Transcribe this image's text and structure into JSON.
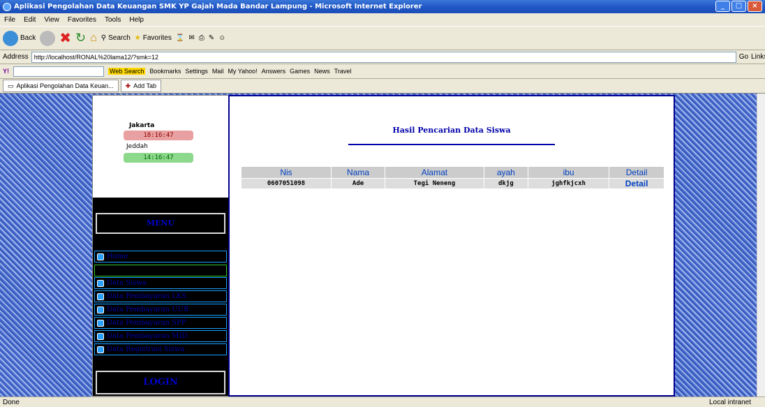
{
  "window": {
    "title": "Aplikasi Pengolahan Data Keuangan SMK YP Gajah Mada Bandar Lampung - Microsoft Internet Explorer"
  },
  "menu": [
    "File",
    "Edit",
    "View",
    "Favorites",
    "Tools",
    "Help"
  ],
  "toolbar": {
    "back": "Back",
    "search": "Search",
    "favorites": "Favorites"
  },
  "address": {
    "label": "Address",
    "url": "http://localhost/RONAL%20lama12/?smk=12",
    "go": "Go",
    "links": "Links"
  },
  "yahoo": {
    "web_search": "Web Search",
    "bookmarks": "Bookmarks",
    "settings": "Settings",
    "mail": "Mail",
    "my_yahoo": "My Yahoo!",
    "answers": "Answers",
    "games": "Games",
    "news": "News",
    "travel": "Travel"
  },
  "tabs": {
    "active": "Aplikasi Pengolahan Data Keuan...",
    "add": "Add Tab"
  },
  "clocks": [
    {
      "city": "Jakarta",
      "time": "18:16:47"
    },
    {
      "city": "Jeddah",
      "time": "14:16:47"
    }
  ],
  "sidebar": {
    "menu_title": "MENU",
    "items": [
      "Home",
      "Data Siswa",
      "Data Pembayaran LKS",
      "Data Pembayaran UUB",
      "Data Pembayaran SPP",
      "Data Pembayaran MID",
      "Data Registrasi Siswa"
    ],
    "login": "LOGIN"
  },
  "main": {
    "title": "Hasil Pencarian Data Siswa",
    "columns": [
      "Nis",
      "Nama",
      "Alamat",
      "ayah",
      "ibu",
      "Detail"
    ],
    "rows": [
      [
        "0607051098",
        "Ade",
        "Tegi Neneng",
        "dkjg",
        "jghfkjcxh",
        "Detail"
      ]
    ]
  },
  "status": {
    "left": "Done",
    "right": "Local intranet"
  }
}
